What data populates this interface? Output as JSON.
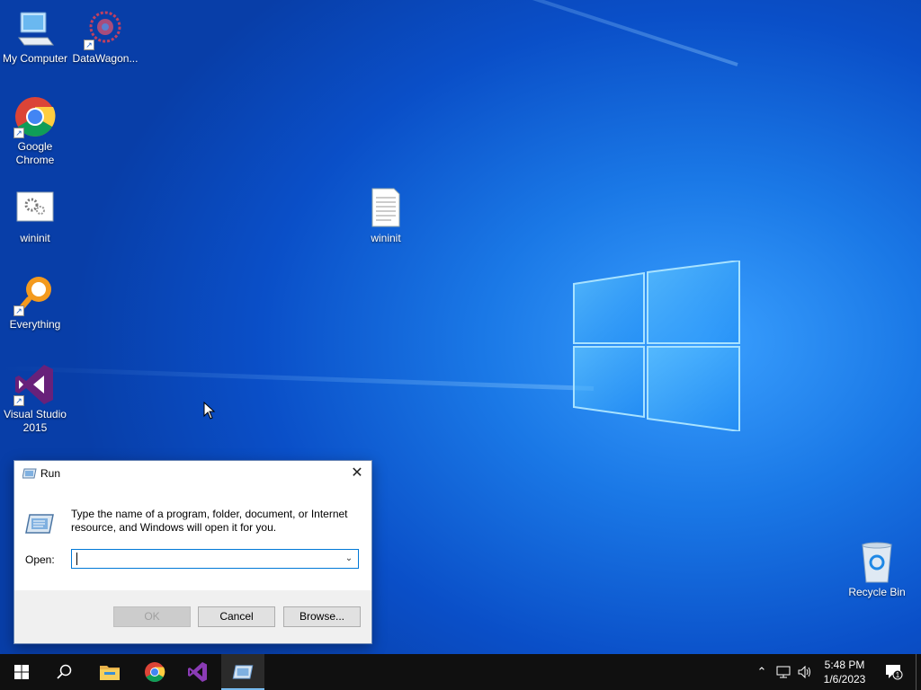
{
  "desktop": {
    "icons": [
      {
        "label": "My Computer",
        "icon": "computer-icon"
      },
      {
        "label": "DataWagon...",
        "icon": "datawagon-icon"
      },
      {
        "label": "Google Chrome",
        "icon": "chrome-icon"
      },
      {
        "label": "wininit",
        "icon": "settings-file-icon"
      },
      {
        "label": "wininit",
        "icon": "text-file-icon"
      },
      {
        "label": "Everything",
        "icon": "everything-search-icon"
      },
      {
        "label": "Visual Studio 2015",
        "icon": "visual-studio-icon"
      },
      {
        "label": "Recycle Bin",
        "icon": "recycle-bin-icon"
      }
    ]
  },
  "run_dialog": {
    "title": "Run",
    "description": "Type the name of a program, folder, document, or Internet resource, and Windows will open it for you.",
    "open_label": "Open:",
    "open_value": "",
    "ok_label": "OK",
    "cancel_label": "Cancel",
    "browse_label": "Browse...",
    "close_glyph": "✕"
  },
  "taskbar": {
    "items": [
      "start-icon",
      "search-icon",
      "file-explorer-icon",
      "chrome-icon",
      "visual-studio-icon",
      "run-icon"
    ],
    "clock": {
      "time": "5:48 PM",
      "date": "1/6/2023"
    },
    "notification_count": "1"
  },
  "colors": {
    "accent": "#0078d7",
    "taskbar": "#101010",
    "desktop_bg": "#0a4fc8"
  }
}
